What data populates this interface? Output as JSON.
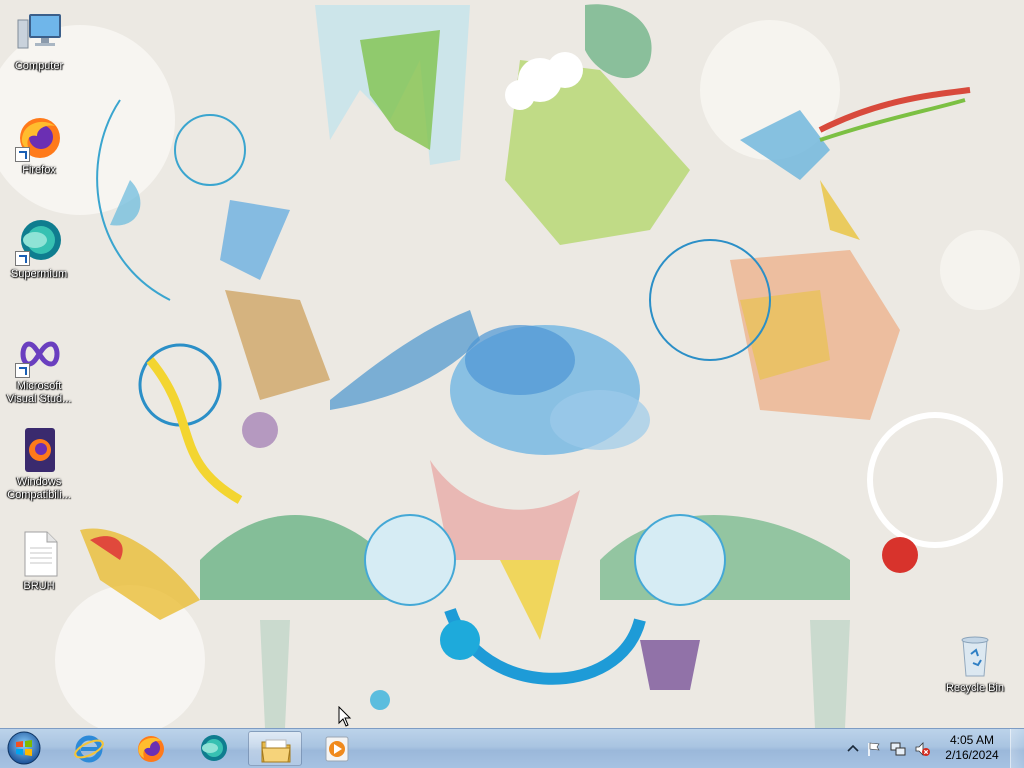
{
  "desktop": {
    "icons": [
      {
        "label": "Computer",
        "icon": "computer-icon"
      },
      {
        "label": "Firefox",
        "icon": "firefox-icon"
      },
      {
        "label": "Supermium",
        "icon": "supermium-icon"
      },
      {
        "label": "Microsoft Visual Stud...",
        "icon": "visual-studio-icon"
      },
      {
        "label": "Windows Compatibili...",
        "icon": "windows-compatibility-icon"
      },
      {
        "label": "BRUH",
        "icon": "text-file-icon"
      },
      {
        "label": "Recycle Bin",
        "icon": "recycle-bin-icon"
      }
    ]
  },
  "taskbar": {
    "start_icon": "windows-start-orb",
    "pinned": [
      {
        "icon": "internet-explorer-icon"
      },
      {
        "icon": "firefox-icon"
      },
      {
        "icon": "supermium-icon"
      },
      {
        "icon": "file-explorer-icon"
      },
      {
        "icon": "media-player-icon"
      }
    ],
    "tray": {
      "icons": [
        "show-hidden-icons-chevron",
        "action-center-flag-icon",
        "network-icon",
        "volume-muted-icon"
      ],
      "time": "4:05 AM",
      "date": "2/16/2024"
    }
  },
  "colors": {
    "taskbar": "#a9c4e1",
    "wallpaper_bg": "#ece9e3"
  }
}
